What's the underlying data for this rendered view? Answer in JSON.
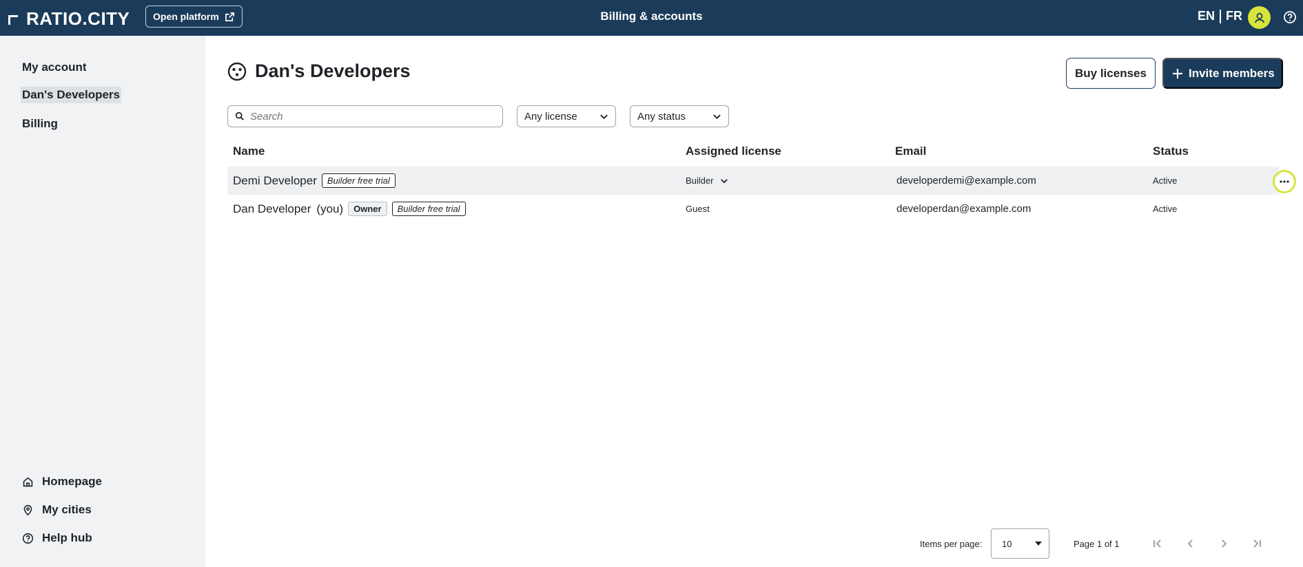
{
  "header": {
    "logo_text": "RATIO.CITY",
    "open_platform_label": "Open platform",
    "title": "Billing & accounts",
    "lang_en": "EN",
    "lang_fr": "FR",
    "avatar_color": "#d6e43c",
    "bg_color": "#1b3b5a"
  },
  "sidebar": {
    "items": [
      {
        "label": "My account"
      },
      {
        "label": "Dan's Developers",
        "active": true
      },
      {
        "label": "Billing"
      }
    ],
    "bottom_items": [
      {
        "label": "Homepage",
        "icon": "home-icon"
      },
      {
        "label": "My cities",
        "icon": "map-pin-icon"
      },
      {
        "label": "Help hub",
        "icon": "help-icon"
      }
    ]
  },
  "main": {
    "title": "Dan's Developers",
    "buy_licenses_label": "Buy licenses",
    "invite_members_label": "Invite members",
    "search_placeholder": "Search",
    "license_filter": "Any license",
    "status_filter": "Any status",
    "columns": [
      "Name",
      "Assigned license",
      "Email",
      "Status"
    ],
    "rows": [
      {
        "name": "Demi Developer",
        "you": "",
        "owner_tag": "",
        "trial_tag": "Builder free trial",
        "license": "Builder",
        "email": "developerdemi@example.com",
        "status": "Active"
      },
      {
        "name": "Dan Developer",
        "you": "(you)",
        "owner_tag": "Owner",
        "trial_tag": "Builder free trial",
        "license": "Guest",
        "email": "developerdan@example.com",
        "status": "Active"
      }
    ]
  },
  "footer": {
    "items_per_page_label": "Items per page:",
    "items_per_page_value": "10",
    "page_info": "Page 1 of 1"
  }
}
